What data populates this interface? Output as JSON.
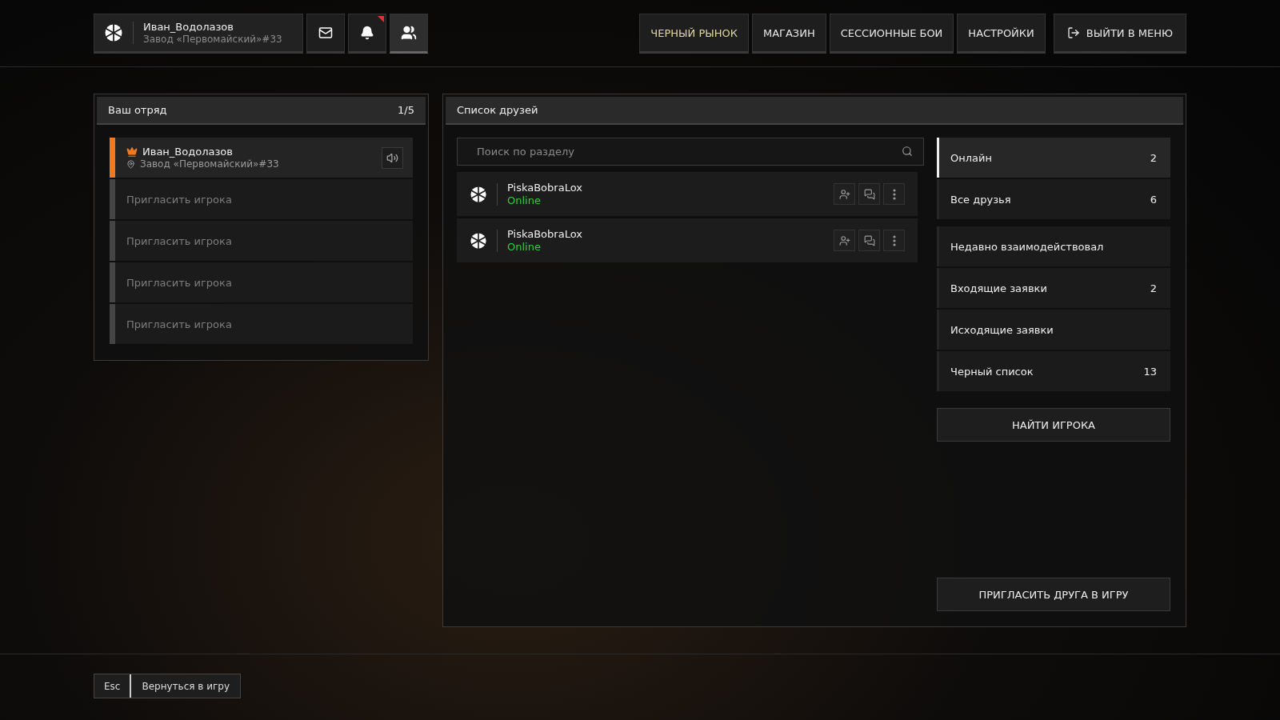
{
  "header": {
    "profile": {
      "name": "Иван_Водолазов",
      "subtitle": "Завод «Первомайский»#33"
    },
    "icon_buttons": [
      {
        "kind": "mail",
        "selected": false,
        "badge": false
      },
      {
        "kind": "bell",
        "selected": false,
        "badge": true
      },
      {
        "kind": "friends",
        "selected": true,
        "badge": false
      }
    ],
    "nav": [
      {
        "label": "ЧЕРНЫЙ РЫНОК",
        "highlighted": true
      },
      {
        "label": "МАГАЗИН",
        "highlighted": false
      },
      {
        "label": "СЕССИОННЫЕ БОИ",
        "highlighted": false
      },
      {
        "label": "НАСТРОЙКИ",
        "highlighted": false
      }
    ],
    "exit_button": "ВЫЙТИ В МЕНЮ"
  },
  "squad": {
    "title": "Ваш отряд",
    "count": "1/5",
    "slots": [
      {
        "kind": "member",
        "name": "Иван_Водолазов",
        "location": "Завод «Первомайский»#33"
      },
      {
        "kind": "invite",
        "label": "Пригласить игрока"
      },
      {
        "kind": "invite",
        "label": "Пригласить игрока"
      },
      {
        "kind": "invite",
        "label": "Пригласить игрока"
      },
      {
        "kind": "invite",
        "label": "Пригласить игрока"
      }
    ]
  },
  "friends": {
    "title": "Список друзей",
    "search": {
      "placeholder": "Поиск по разделу"
    },
    "list": [
      {
        "name": "PiskaBobraLox",
        "status": "Online"
      },
      {
        "name": "PiskaBobraLox",
        "status": "Online"
      }
    ],
    "categories": [
      {
        "label": "Онлайн",
        "count": "2",
        "selected": true
      },
      {
        "label": "Все друзья",
        "count": "6",
        "selected": false
      },
      {
        "label": "Недавно взаимодействовал",
        "selected": false
      },
      {
        "label": "Входящие заявки",
        "count": "2",
        "selected": false
      },
      {
        "label": "Исходящие заявки",
        "selected": false
      },
      {
        "label": "Черный список",
        "count": "13",
        "selected": false
      }
    ],
    "find_button": "НАЙТИ ИГРОКА",
    "invite_button": "ПРИГЛАСИТЬ ДРУГА В ИГРУ"
  },
  "footer": {
    "key": "Esc",
    "label": "Вернуться в игру"
  }
}
